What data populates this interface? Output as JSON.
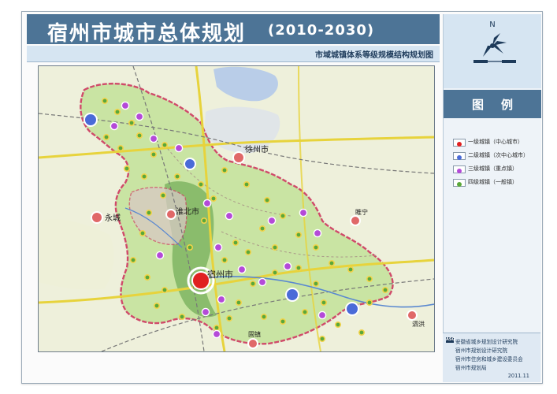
{
  "header": {
    "title": "宿州市城市总体规划",
    "years": "(2010-2030)",
    "subtitle": "市域城镇体系等级规模结构规划图"
  },
  "legend": {
    "title": "图例",
    "items": [
      {
        "label": "一级城镇（中心城市）",
        "color": "#e02020"
      },
      {
        "label": "二级城镇（次中心城市）",
        "color": "#4a6bd8"
      },
      {
        "label": "三级城镇（重点镇）",
        "color": "#b44ad8"
      },
      {
        "label": "四级城镇（一般镇）",
        "color": "#5aa83a"
      }
    ]
  },
  "north_arrow": {
    "letter": "N"
  },
  "credits": {
    "badge": "ASG",
    "lines": [
      "安徽省城乡规划设计研究院",
      "宿州市规划设计研究院",
      "宿州市住房和城乡建设委员会",
      "宿州市规划局"
    ],
    "date": "2011.11"
  },
  "map": {
    "cities": [
      {
        "name": "徐州市",
        "color": "#e06868"
      },
      {
        "name": "永城",
        "color": "#e06868"
      },
      {
        "name": "淮北市",
        "color": "#e06868"
      },
      {
        "name": "睢宁",
        "color": "#e06868"
      },
      {
        "name": "宿州市",
        "color": "#e02020"
      },
      {
        "name": "泗洪",
        "color": "#e06868"
      },
      {
        "name": "固镇",
        "color": "#e06868"
      }
    ],
    "colors": {
      "region_fill": "#c9e4a3",
      "region_border": "#d04a6a",
      "outside": "#f1f0da",
      "lake": "#b9cde8",
      "highway": "#e7d33c"
    }
  }
}
